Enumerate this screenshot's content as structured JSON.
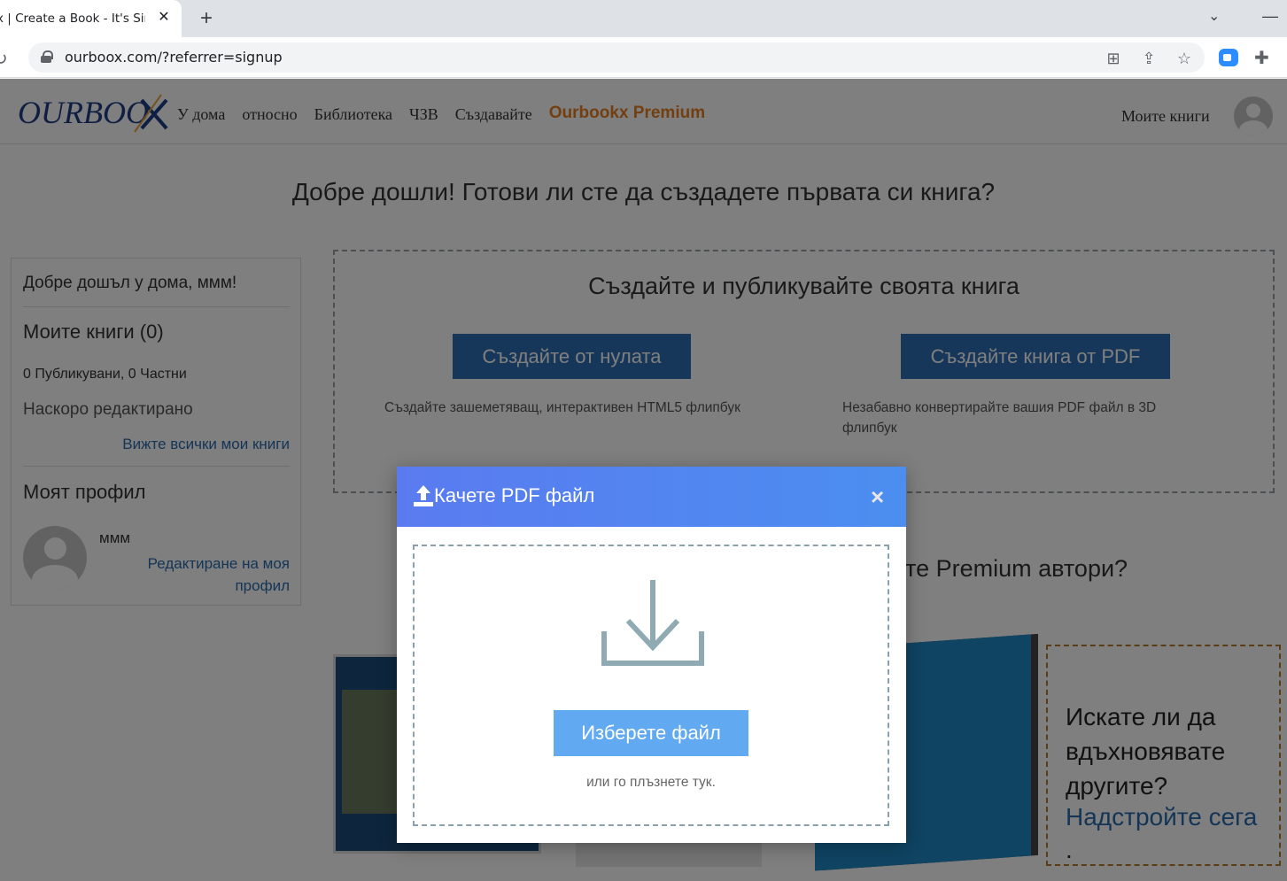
{
  "browser": {
    "tab_title": "x | Create a Book - It's Sir",
    "tab_close": "✕",
    "new_tab": "+",
    "url": "ourboox.com/?referrer=signup"
  },
  "header": {
    "nav": [
      "У дома",
      "относно",
      "Библиотека",
      "ЧЗВ",
      "Създавайте"
    ],
    "premium": "Ourbookx Premium",
    "my_books": "Моите книги"
  },
  "main": {
    "welcome": "Добре дошли! Готови ли сте да създадете първата си книга?",
    "create_title": "Създайте и публикувайте своята книга",
    "btn_scratch": "Създайте от нулата",
    "btn_pdf": "Създайте книга от PDF",
    "desc_scratch": "Създайте зашеметяващ, интерактивен HTML5 флипбук",
    "desc_pdf": "Незабавно конвертирайте вашия PDF файл в 3D флипбук",
    "premium_q": "те Premium автори?"
  },
  "sidebar": {
    "greeting": "Добре дошъл у дома, ммм!",
    "my_books": "Моите книги (0)",
    "counts": "0 Публикувани, 0 Частни",
    "recent": "Наскоро редактирано",
    "see_all": "Вижте всички мои книги",
    "profile_title": "Моят профил",
    "username": "ммм",
    "edit_profile": "Редактиране на моя профил"
  },
  "upgrade": {
    "text": "Искате ли да вдъхновявате другите?",
    "link": "Надстройте сега",
    "dot": "."
  },
  "modal": {
    "title": "Качете PDF файл",
    "close": "×",
    "choose": "Изберете файл",
    "hint": "или го плъзнете тук."
  },
  "colors": {
    "accent": "#2f6fb5",
    "premium": "#e67e22",
    "modal_header": "#4b8ef0",
    "choose_button": "#61aaf2"
  }
}
